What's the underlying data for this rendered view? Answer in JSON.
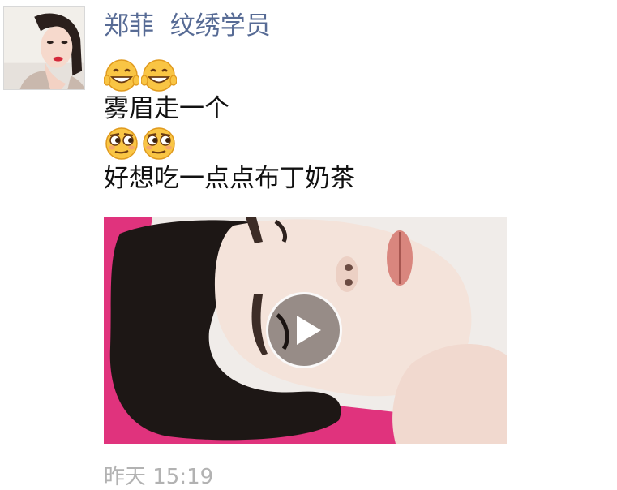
{
  "post": {
    "author": {
      "display_name": "郑菲  纹绣学员",
      "avatar_icon": "profile-photo"
    },
    "emoji_rows": [
      {
        "icons": [
          "grin-emoji",
          "grin-emoji"
        ]
      },
      {
        "icons": [
          "smirk-emoji",
          "smirk-emoji"
        ]
      }
    ],
    "text_lines": [
      "雾眉走一个",
      "好想吃一点点布丁奶茶"
    ],
    "media": {
      "type": "video",
      "play_icon": "play-icon"
    },
    "timestamp": "昨天 15:19"
  },
  "colors": {
    "author_name": "#576b95",
    "body_text": "#111111",
    "timestamp": "#b2b2b2",
    "background": "#ffffff",
    "video_accent": "#e0337d"
  }
}
